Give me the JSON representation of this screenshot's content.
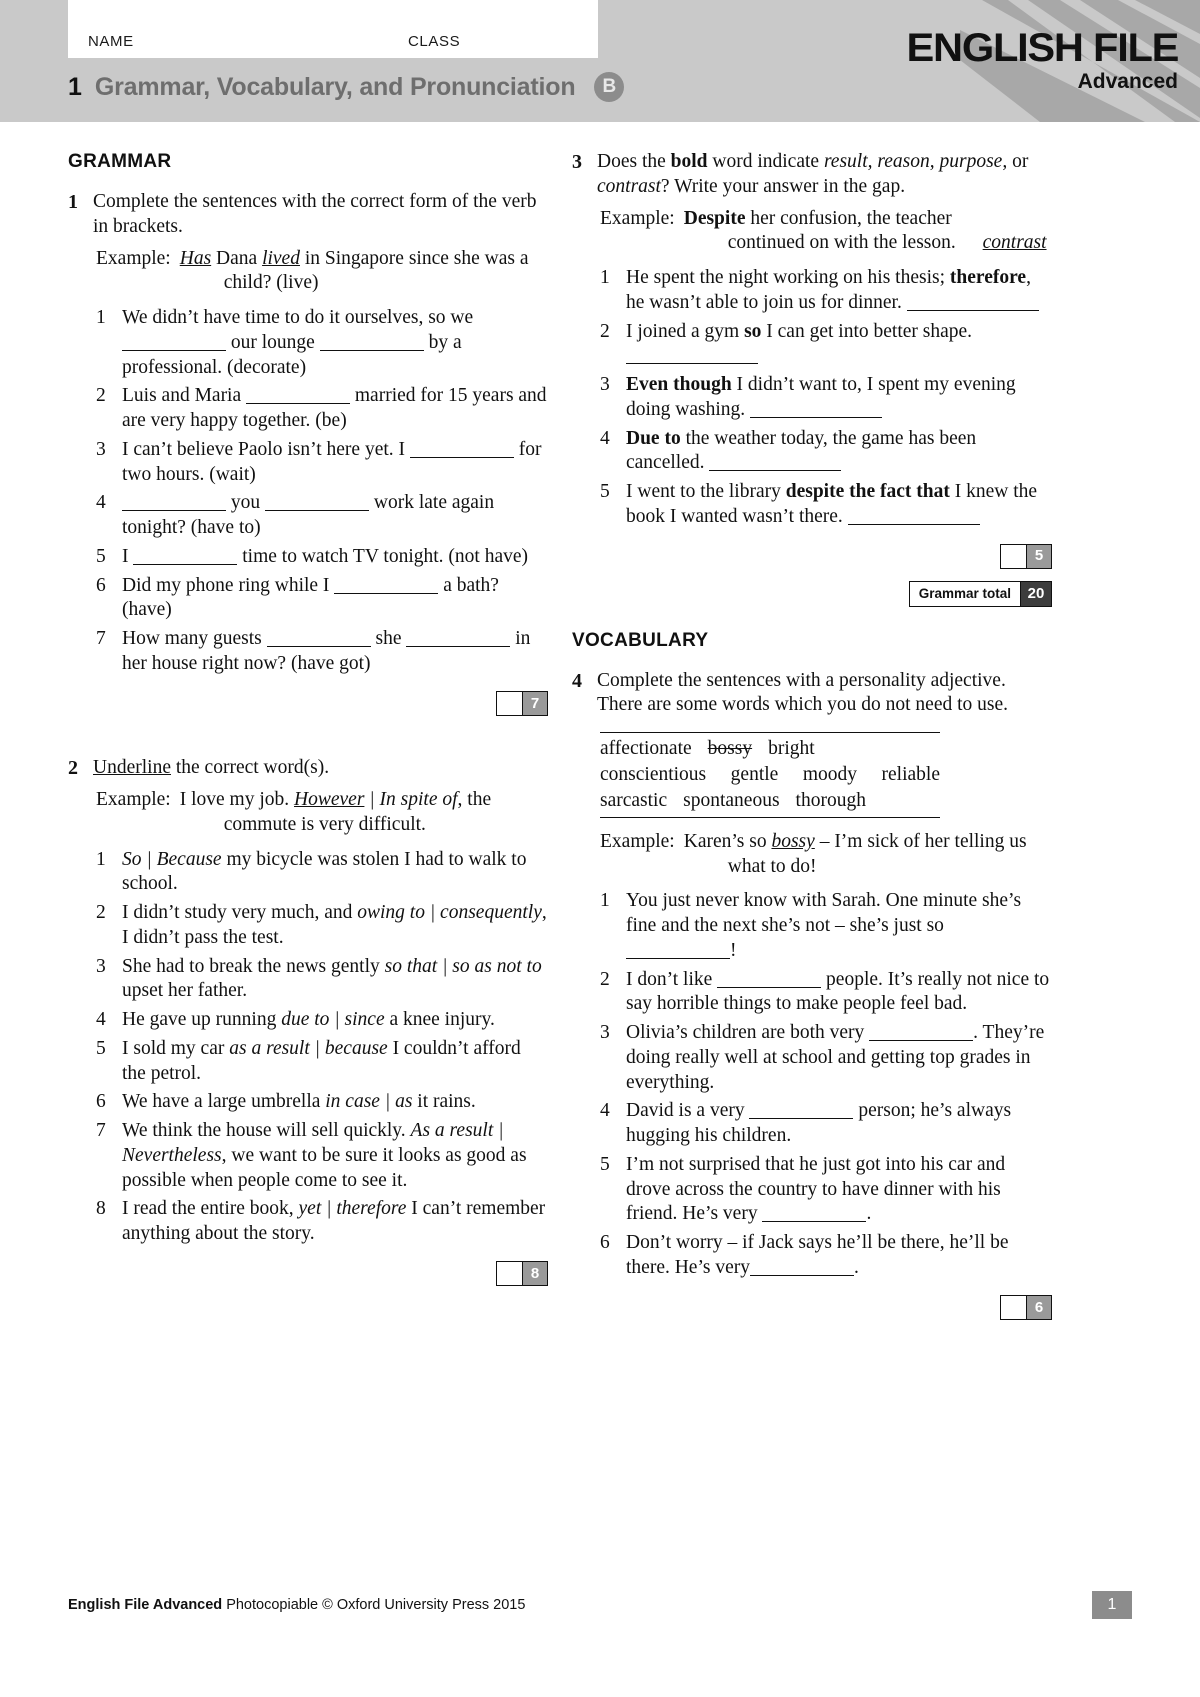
{
  "header": {
    "name_label": "NAME",
    "class_label": "CLASS",
    "unit_number": "1",
    "unit_title": "Grammar, Vocabulary, and Pronunciation",
    "version_badge": "B",
    "brand_main": "ENGLISH FILE",
    "brand_sub": "Advanced"
  },
  "grammar": {
    "section_title": "GRAMMAR",
    "ex1": {
      "number": "1",
      "instruction": "Complete the sentences with the correct form of the verb in brackets.",
      "example_label": "Example:",
      "example_line1_a": "Has",
      "example_line1_b": " Dana ",
      "example_line1_c": "lived",
      "example_line1_d": " in Singapore since she was a",
      "example_line2": "child? (live)",
      "items": [
        {
          "n": "1",
          "a": "We didn’t have time to do it ourselves, so we ",
          "b": " our lounge ",
          "c": " by a professional. (decorate)"
        },
        {
          "n": "2",
          "a": "Luis and Maria ",
          "b": " married for 15 years and are very happy together. (be)"
        },
        {
          "n": "3",
          "a": "I can’t believe Paolo isn’t here yet. I ",
          "b": " for two hours. (wait)"
        },
        {
          "n": "4",
          "a": "",
          "b": " you ",
          "c": " work late again tonight? (have to)"
        },
        {
          "n": "5",
          "a": "I ",
          "b": " time to watch TV tonight. (not have)"
        },
        {
          "n": "6",
          "a": "Did my phone ring while I ",
          "b": " a bath? (have)"
        },
        {
          "n": "7",
          "a": "How many guests ",
          "b": " she ",
          "c": " in her house right now? (have got)"
        }
      ],
      "score": "7"
    },
    "ex2": {
      "number": "2",
      "instruction_underlined": "Underline",
      "instruction_rest": " the correct word(s).",
      "example_label": "Example:",
      "example_line1_a": "I love my job. ",
      "example_line1_b": "However",
      "example_line1_c": " | ",
      "example_line1_d": "In spite of",
      "example_line1_e": ", the",
      "example_line2": "commute is very difficult.",
      "items": [
        {
          "n": "1",
          "pre": "",
          "opt": "So | Because",
          "post": " my bicycle was stolen I had to walk to school."
        },
        {
          "n": "2",
          "pre": "I didn’t study very much, and ",
          "opt": "owing to | consequently",
          "post": ", I didn’t pass the test."
        },
        {
          "n": "3",
          "pre": "She had to break the news gently ",
          "opt": "so that | so as not to",
          "post": " upset her father."
        },
        {
          "n": "4",
          "pre": "He gave up running ",
          "opt": "due to | since",
          "post": " a knee injury."
        },
        {
          "n": "5",
          "pre": "I sold my car ",
          "opt": "as a result | because",
          "post": " I couldn’t afford the petrol."
        },
        {
          "n": "6",
          "pre": "We have a large umbrella ",
          "opt": "in case | as",
          "post": " it rains."
        },
        {
          "n": "7",
          "pre": "We think the house will sell quickly. ",
          "opt": "As a result | Nevertheless",
          "post": ", we want to be sure it looks as good as possible when people come to see it."
        },
        {
          "n": "8",
          "pre": "I read the entire book, ",
          "opt": "yet | therefore",
          "post": " I can’t remember anything about the story."
        }
      ],
      "score": "8"
    },
    "ex3": {
      "number": "3",
      "instruction_a": "Does the ",
      "instruction_bold": "bold",
      "instruction_b": " word indicate ",
      "instruction_italic": "result, reason, purpose,",
      "instruction_c": " or ",
      "instruction_italic2": "contrast",
      "instruction_d": "? Write your answer in the gap.",
      "example_label": "Example:",
      "example_bold": "Despite",
      "example_rest": " her confusion, the teacher",
      "example_line2": "continued on with the lesson.",
      "example_answer": "contrast",
      "items": [
        {
          "n": "1",
          "pre": "He spent the night working on his thesis; ",
          "bold": "therefore",
          "post": ", he wasn’t able to join us for dinner."
        },
        {
          "n": "2",
          "pre": "I joined a gym ",
          "bold": "so",
          "post": " I can get into better shape."
        },
        {
          "n": "3",
          "pre": "",
          "bold": "Even though",
          "post": " I didn’t want to, I spent my evening doing washing."
        },
        {
          "n": "4",
          "pre": "",
          "bold": "Due to",
          "post": " the weather today, the game has been cancelled."
        },
        {
          "n": "5",
          "pre": "I went to the library ",
          "bold": "despite the fact that",
          "post": " I knew the book I wanted wasn’t there."
        }
      ],
      "score": "5",
      "total_label": "Grammar total",
      "total_value": "20"
    }
  },
  "vocabulary": {
    "section_title": "VOCABULARY",
    "ex4": {
      "number": "4",
      "instruction": "Complete the sentences with a personality adjective. There are some words which you do not need to use.",
      "wordbank_row1": [
        "affectionate",
        "bossy",
        "bright"
      ],
      "wordbank_row1_strike": "bossy",
      "wordbank_row2": [
        "conscientious",
        "gentle",
        "moody",
        "reliable"
      ],
      "wordbank_row3": [
        "sarcastic",
        "spontaneous",
        "thorough"
      ],
      "example_label": "Example:",
      "example_a": "Karen’s so ",
      "example_b": "bossy",
      "example_c": " – I’m sick of her telling us",
      "example_line2": "what to do!",
      "items": [
        {
          "n": "1",
          "a": "You just never know with Sarah. One minute she’s fine and the next she’s not – she’s just so ",
          "b": "!"
        },
        {
          "n": "2",
          "a": "I don’t like ",
          "b": " people. It’s really not nice to say horrible things to make people feel bad."
        },
        {
          "n": "3",
          "a": "Olivia’s children are both very ",
          "b": ". They’re doing really well at school and getting top grades in everything."
        },
        {
          "n": "4",
          "a": "David is a very ",
          "b": " person; he’s always hugging his children."
        },
        {
          "n": "5",
          "a": "I’m not surprised that he just got into his car and drove across the country to have dinner with his friend. He’s very ",
          "b": "."
        },
        {
          "n": "6",
          "a": "Don’t worry – if Jack says he’ll be there, he’ll be there. He’s very",
          "b": "."
        }
      ],
      "score": "6"
    }
  },
  "footer": {
    "title": "English File Advanced",
    "credit": " Photocopiable © Oxford University Press 2015",
    "page": "1"
  }
}
